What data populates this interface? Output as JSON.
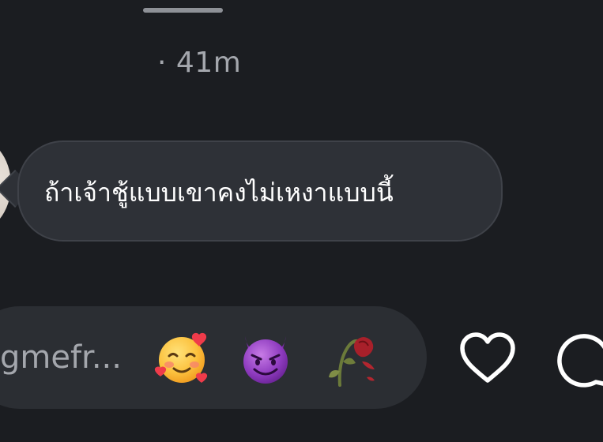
{
  "story": {
    "timestamp": "· 41m",
    "message": "ถ้าเจ้าชู้แบบเขาคงไม่เหงาแบบนี้"
  },
  "reply": {
    "placeholder": "gmefr..."
  },
  "quick_reactions": [
    {
      "name": "smiling-face-with-hearts",
      "icon": "smiling-face-with-hearts-icon"
    },
    {
      "name": "smiling-face-with-horns",
      "icon": "smiling-face-with-horns-icon"
    },
    {
      "name": "wilted-flower",
      "icon": "wilted-flower-icon"
    }
  ],
  "actions": [
    {
      "name": "like",
      "icon": "heart-icon"
    },
    {
      "name": "comment",
      "icon": "comment-icon"
    }
  ],
  "colors": {
    "background": "#1b1d21",
    "bubble": "#2e3137",
    "reply_bar": "#2b2e33",
    "secondary_text": "#a4a7ad"
  }
}
